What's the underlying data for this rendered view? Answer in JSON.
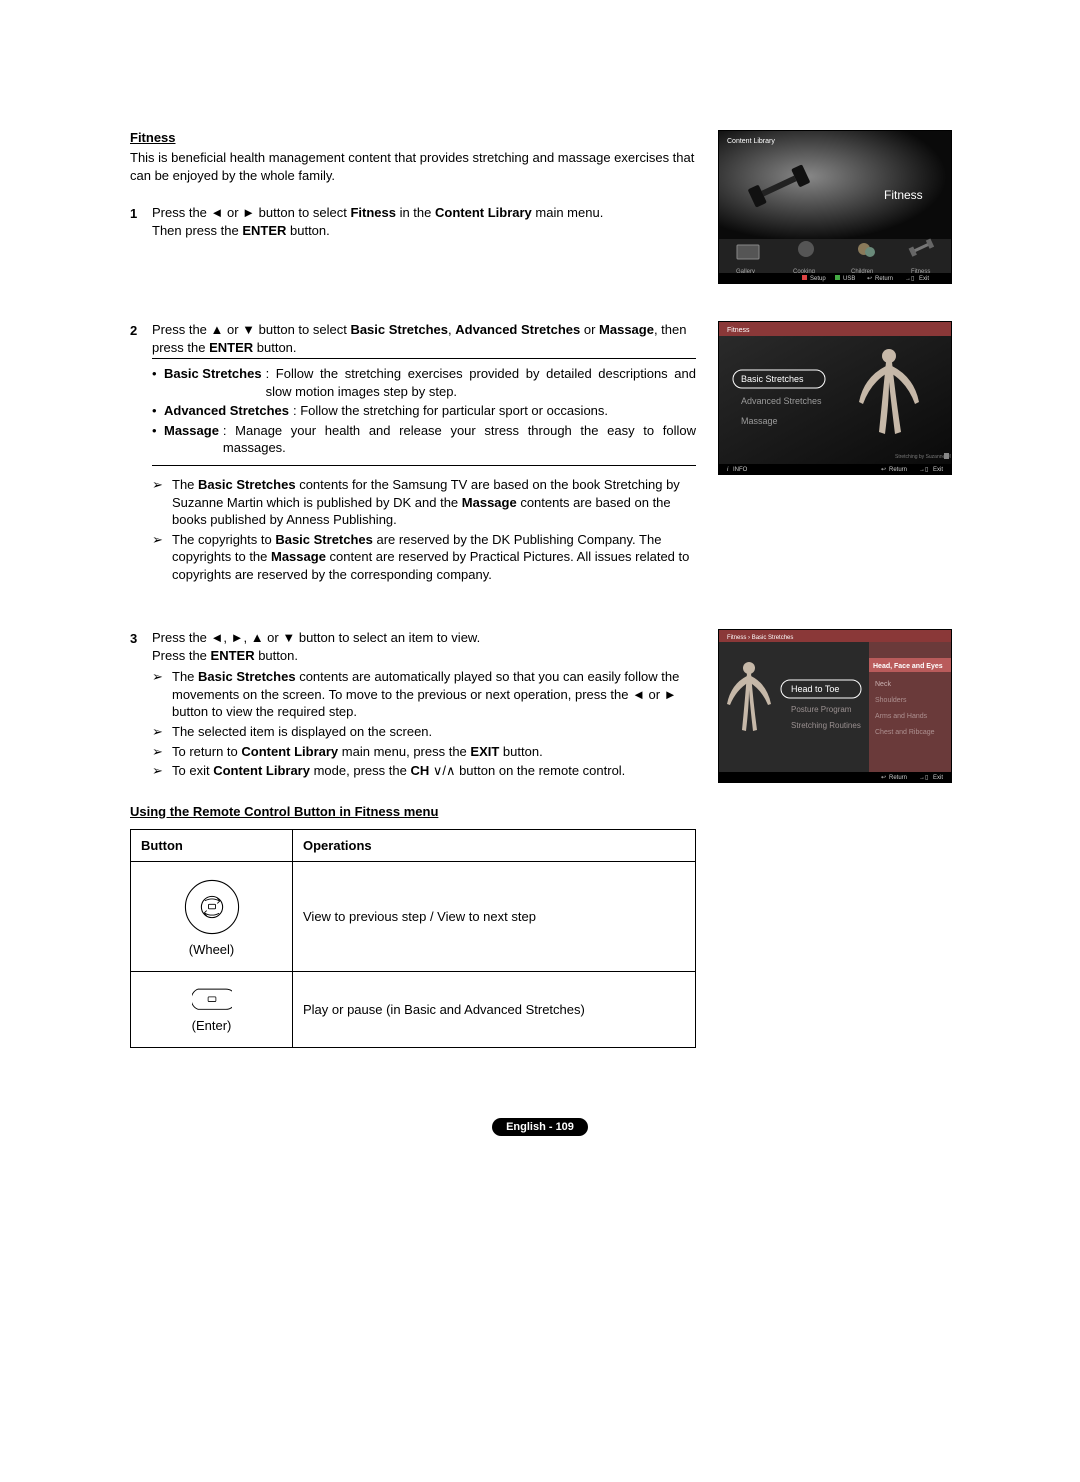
{
  "heading": "Fitness",
  "intro": "This is beneficial health management content that provides stretching and massage exercises that can be enjoyed by the whole family.",
  "steps": [
    {
      "num": "1",
      "line1_a": "Press the ◄ or ► button to select ",
      "line1_b": "Fitness",
      "line1_c": " in the ",
      "line1_d": "Content Library",
      "line1_e": " main menu.",
      "line2_a": "Then press the ",
      "line2_b": "ENTER",
      "line2_c": " button."
    },
    {
      "num": "2",
      "line1_a": "Press the ▲ or ▼ button to select ",
      "line1_b": "Basic Stretches",
      "line1_c": ", ",
      "line1_d": "Advanced Stretches",
      "line1_e": " or ",
      "line1_f": "Massage",
      "line1_g": ", then press the ",
      "line1_h": "ENTER",
      "line1_i": " button.",
      "bullets": [
        {
          "label": "Basic Stretches",
          "text": ": Follow the stretching exercises provided by detailed descriptions and slow motion images step by step."
        },
        {
          "label": "Advanced Stretches",
          "text": ": Follow the stretching for particular sport or occasions."
        },
        {
          "label": "Massage",
          "text": ": Manage your health and release your stress through the easy to follow massages."
        }
      ],
      "arrows": [
        {
          "spans": [
            {
              "t": "The "
            },
            {
              "t": "Basic Stretches",
              "b": true
            },
            {
              "t": " contents for the Samsung TV are based on the book Stretching by Suzanne Martin which is published by DK and the "
            },
            {
              "t": "Massage",
              "b": true
            },
            {
              "t": " contents are based on the books published by Anness Publishing."
            }
          ]
        },
        {
          "spans": [
            {
              "t": "The copyrights to "
            },
            {
              "t": "Basic Stretches",
              "b": true
            },
            {
              "t": " are reserved by the DK Publishing Company. The copyrights to the "
            },
            {
              "t": "Massage",
              "b": true
            },
            {
              "t": " content are reserved by Practical Pictures. All issues related to copyrights are reserved by the corresponding company."
            }
          ]
        }
      ]
    },
    {
      "num": "3",
      "line1": "Press the ◄, ►, ▲ or ▼ button to select an item to view.",
      "line2_a": "Press the ",
      "line2_b": "ENTER",
      "line2_c": " button.",
      "arrows": [
        {
          "spans": [
            {
              "t": "The "
            },
            {
              "t": "Basic Stretches",
              "b": true
            },
            {
              "t": " contents are automatically played so that you can easily follow the movements on the screen. To move to the previous or next operation, press the ◄ or ► button to view the required step."
            }
          ]
        },
        {
          "spans": [
            {
              "t": "The selected item is displayed on the screen."
            }
          ]
        },
        {
          "spans": [
            {
              "t": "To return to "
            },
            {
              "t": "Content Library",
              "b": true
            },
            {
              "t": " main menu, press the "
            },
            {
              "t": "EXIT",
              "b": true
            },
            {
              "t": " button."
            }
          ]
        },
        {
          "spans": [
            {
              "t": "To exit "
            },
            {
              "t": "Content Library",
              "b": true
            },
            {
              "t": " mode, press the "
            },
            {
              "t": "CH ",
              "b": true
            },
            {
              "t": "∨/∧ button on the remote control."
            }
          ]
        }
      ]
    }
  ],
  "sub_heading": "Using the Remote Control Button in Fitness menu",
  "table": {
    "head_button": "Button",
    "head_ops": "Operations",
    "rows": [
      {
        "label": "(Wheel)",
        "ops": "View to previous step / View to next step",
        "icon": "wheel"
      },
      {
        "label": "(Enter)",
        "ops": "Play or pause (in Basic and Advanced Stretches)",
        "icon": "enter"
      }
    ]
  },
  "screenshots": {
    "s1": {
      "title": "Content Library",
      "big_label": "Fitness",
      "menu": [
        "Gallery",
        "Cooking",
        "Children",
        "Fitness"
      ],
      "footer": [
        "Setup",
        "USB",
        "Return",
        "Exit"
      ],
      "footer_icons": [
        "square",
        "square",
        "return",
        "exit"
      ]
    },
    "s2": {
      "title": "Fitness",
      "items": [
        "Basic Stretches",
        "Advanced Stretches",
        "Massage"
      ],
      "info": "INFO",
      "footer": [
        "Return",
        "Exit"
      ]
    },
    "s3": {
      "title_a": "Fitness",
      "title_b": "Basic Stretches",
      "left_items": [
        "Head to Toe",
        "Posture Program",
        "Stretching Routines"
      ],
      "right_head": "Head, Face and Eyes",
      "right_items": [
        "Neck",
        "Shoulders",
        "Arms and Hands",
        "Chest and Ribcage"
      ],
      "footer": [
        "Return",
        "Exit"
      ]
    }
  },
  "footer": "English - 109"
}
